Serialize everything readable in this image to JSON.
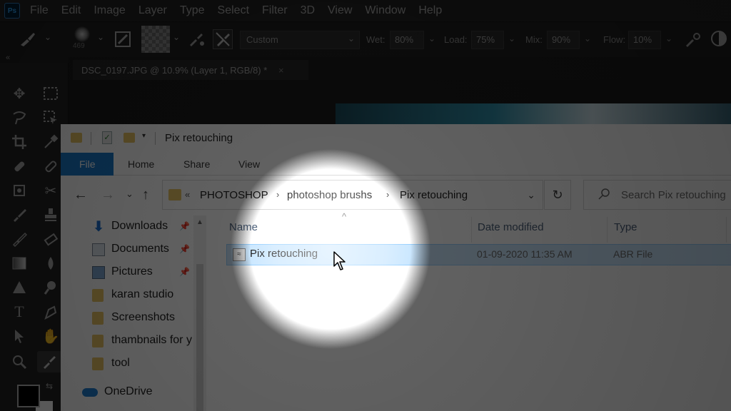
{
  "photoshop": {
    "logo": "Ps",
    "menu": [
      "File",
      "Edit",
      "Image",
      "Layer",
      "Type",
      "Select",
      "Filter",
      "3D",
      "View",
      "Window",
      "Help"
    ],
    "options": {
      "brush_size": "469",
      "preset": "Custom",
      "wet_label": "Wet:",
      "wet_value": "80%",
      "load_label": "Load:",
      "load_value": "75%",
      "mix_label": "Mix:",
      "mix_value": "90%",
      "flow_label": "Flow:",
      "flow_value": "10%"
    },
    "collapse_glyph": "«",
    "document_tab": "DSC_0197.JPG @ 10.9% (Layer 1, RGB/8) *",
    "document_tab_close": "×"
  },
  "explorer": {
    "title": "Pix retouching",
    "ribbon": {
      "file": "File",
      "home": "Home",
      "share": "Share",
      "view": "View"
    },
    "address": {
      "prefix": "«",
      "segments": [
        "PHOTOSHOP",
        "photoshop brushs",
        "Pix retouching"
      ],
      "separator": "›"
    },
    "search_placeholder": "Search Pix retouching",
    "nav_items": [
      {
        "label": "Downloads",
        "icon": "download-arrow-icon",
        "pinned": true
      },
      {
        "label": "Documents",
        "icon": "documents-icon",
        "pinned": true
      },
      {
        "label": "Pictures",
        "icon": "pictures-icon",
        "pinned": true
      },
      {
        "label": "karan studio",
        "icon": "folder-icon",
        "pinned": false
      },
      {
        "label": "Screenshots",
        "icon": "folder-icon",
        "pinned": false
      },
      {
        "label": "thambnails for y",
        "icon": "folder-icon",
        "pinned": false
      },
      {
        "label": "tool",
        "icon": "folder-icon",
        "pinned": false
      }
    ],
    "onedrive_label": "OneDrive",
    "columns": {
      "name": "Name",
      "date": "Date modified",
      "type": "Type"
    },
    "files": [
      {
        "name": "Pix retouching",
        "date": "01-09-2020 11:35 AM",
        "type": "ABR File",
        "selected": true
      }
    ]
  },
  "colors": {
    "ps_background": "#1e1e1e",
    "explorer_accent": "#1979ca",
    "selection": "#cce8ff",
    "folder": "#e9c564"
  }
}
